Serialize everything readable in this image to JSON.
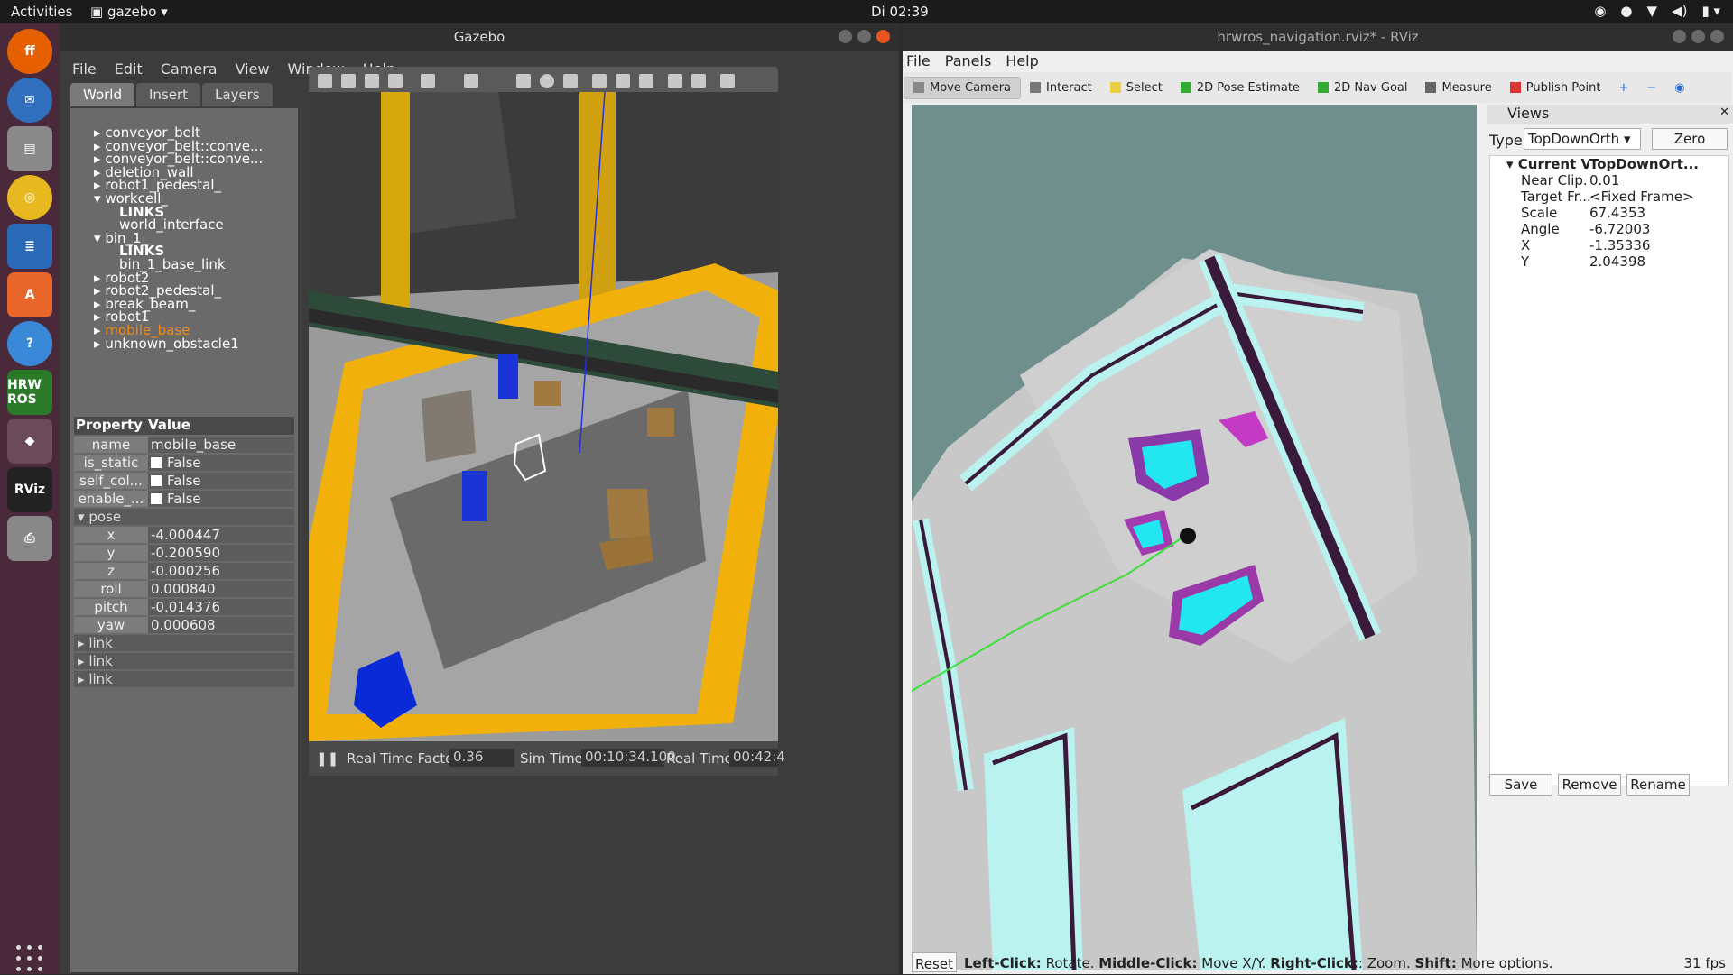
{
  "topbar": {
    "activities": "Activities",
    "app_name": "gazebo",
    "clock": "Di 02:39"
  },
  "dock": {
    "items": [
      {
        "name": "firefox-icon"
      },
      {
        "name": "thunderbird-icon"
      },
      {
        "name": "files-icon"
      },
      {
        "name": "rhythmbox-icon"
      },
      {
        "name": "writer-icon"
      },
      {
        "name": "software-icon"
      },
      {
        "name": "help-icon"
      },
      {
        "name": "hrwros-icon",
        "label": "HRW ROS"
      },
      {
        "name": "gazebo-icon"
      },
      {
        "name": "rviz-icon",
        "label": "RViz"
      },
      {
        "name": "printer-icon"
      }
    ]
  },
  "gazebo": {
    "title": "Gazebo",
    "menu": [
      "File",
      "Edit",
      "Camera",
      "View",
      "Window",
      "Help"
    ],
    "tabs": [
      "World",
      "Insert",
      "Layers"
    ],
    "tree": [
      {
        "label": "conveyor_belt",
        "indent": 0,
        "arrow": "right"
      },
      {
        "label": "conveyor_belt::conve...",
        "indent": 0,
        "arrow": "right"
      },
      {
        "label": "conveyor_belt::conve...",
        "indent": 0,
        "arrow": "right"
      },
      {
        "label": "deletion_wall",
        "indent": 0,
        "arrow": "right"
      },
      {
        "label": "robot1_pedestal_",
        "indent": 0,
        "arrow": "right"
      },
      {
        "label": "workcell_",
        "indent": 0,
        "arrow": "down"
      },
      {
        "label": "LINKS",
        "indent": 1,
        "arrow": "",
        "bold": true
      },
      {
        "label": "world_interface",
        "indent": 1,
        "arrow": ""
      },
      {
        "label": "bin_1_",
        "indent": 0,
        "arrow": "down"
      },
      {
        "label": "LINKS",
        "indent": 1,
        "arrow": "",
        "bold": true
      },
      {
        "label": "bin_1_base_link",
        "indent": 1,
        "arrow": ""
      },
      {
        "label": "robot2",
        "indent": 0,
        "arrow": "right"
      },
      {
        "label": "robot2_pedestal_",
        "indent": 0,
        "arrow": "right"
      },
      {
        "label": "break_beam_",
        "indent": 0,
        "arrow": "right"
      },
      {
        "label": "robot1",
        "indent": 0,
        "arrow": "right"
      },
      {
        "label": "mobile_base",
        "indent": 0,
        "arrow": "right",
        "highlight": true
      },
      {
        "label": "unknown_obstacle1",
        "indent": 0,
        "arrow": "right"
      }
    ],
    "props_header": {
      "property": "Property",
      "value": "Value"
    },
    "props": [
      {
        "k": "name",
        "v": "mobile_base",
        "check": false
      },
      {
        "k": "is_static",
        "v": "False",
        "check": true
      },
      {
        "k": "self_col...",
        "v": "False",
        "check": true
      },
      {
        "k": "enable_...",
        "v": "False",
        "check": true
      }
    ],
    "pose_label": "pose",
    "pose": [
      {
        "k": "x",
        "v": "-4.000447"
      },
      {
        "k": "y",
        "v": "-0.200590"
      },
      {
        "k": "z",
        "v": "-0.000256"
      },
      {
        "k": "roll",
        "v": "0.000840"
      },
      {
        "k": "pitch",
        "v": "-0.014376"
      },
      {
        "k": "yaw",
        "v": "0.000608"
      }
    ],
    "links": [
      "link",
      "link",
      "link"
    ],
    "status": {
      "rtf_label": "Real Time Factor:",
      "rtf": "0.36",
      "sim_label": "Sim Time:",
      "sim": "00:10:34.100",
      "real_label": "Real Time:",
      "real": "00:42:4"
    }
  },
  "rviz": {
    "title": "hrwros_navigation.rviz* - RViz",
    "menu": [
      "File",
      "Panels",
      "Help"
    ],
    "tools": [
      {
        "label": "Move Camera",
        "icon": "move-camera-icon",
        "selected": true
      },
      {
        "label": "Interact",
        "icon": "interact-icon"
      },
      {
        "label": "Select",
        "icon": "select-icon"
      },
      {
        "label": "2D Pose Estimate",
        "icon": "pose-estimate-icon"
      },
      {
        "label": "2D Nav Goal",
        "icon": "nav-goal-icon"
      },
      {
        "label": "Measure",
        "icon": "measure-icon"
      },
      {
        "label": "Publish Point",
        "icon": "publish-point-icon"
      }
    ],
    "views": {
      "header": "Views",
      "type_label": "Type:",
      "type_value": "TopDownOrth",
      "zero": "Zero",
      "rows": [
        {
          "k": "Current Vi...",
          "v": "TopDownOrt...",
          "bold": true
        },
        {
          "k": "Near Clip...",
          "v": "0.01"
        },
        {
          "k": "Target Fr...",
          "v": "<Fixed Frame>"
        },
        {
          "k": "Scale",
          "v": "67.4353"
        },
        {
          "k": "Angle",
          "v": "-6.72003"
        },
        {
          "k": "X",
          "v": "-1.35336"
        },
        {
          "k": "Y",
          "v": "2.04398"
        }
      ],
      "buttons": [
        "Save",
        "Remove",
        "Rename"
      ]
    },
    "status": {
      "reset": "Reset",
      "help_parts": [
        {
          "b": "Left-Click:",
          "t": " Rotate. "
        },
        {
          "b": "Middle-Click:",
          "t": " Move X/Y. "
        },
        {
          "b": "Right-Click:",
          "t": ": Zoom. "
        },
        {
          "b": "Shift:",
          "t": " More options."
        }
      ],
      "fps": "31 fps"
    }
  }
}
